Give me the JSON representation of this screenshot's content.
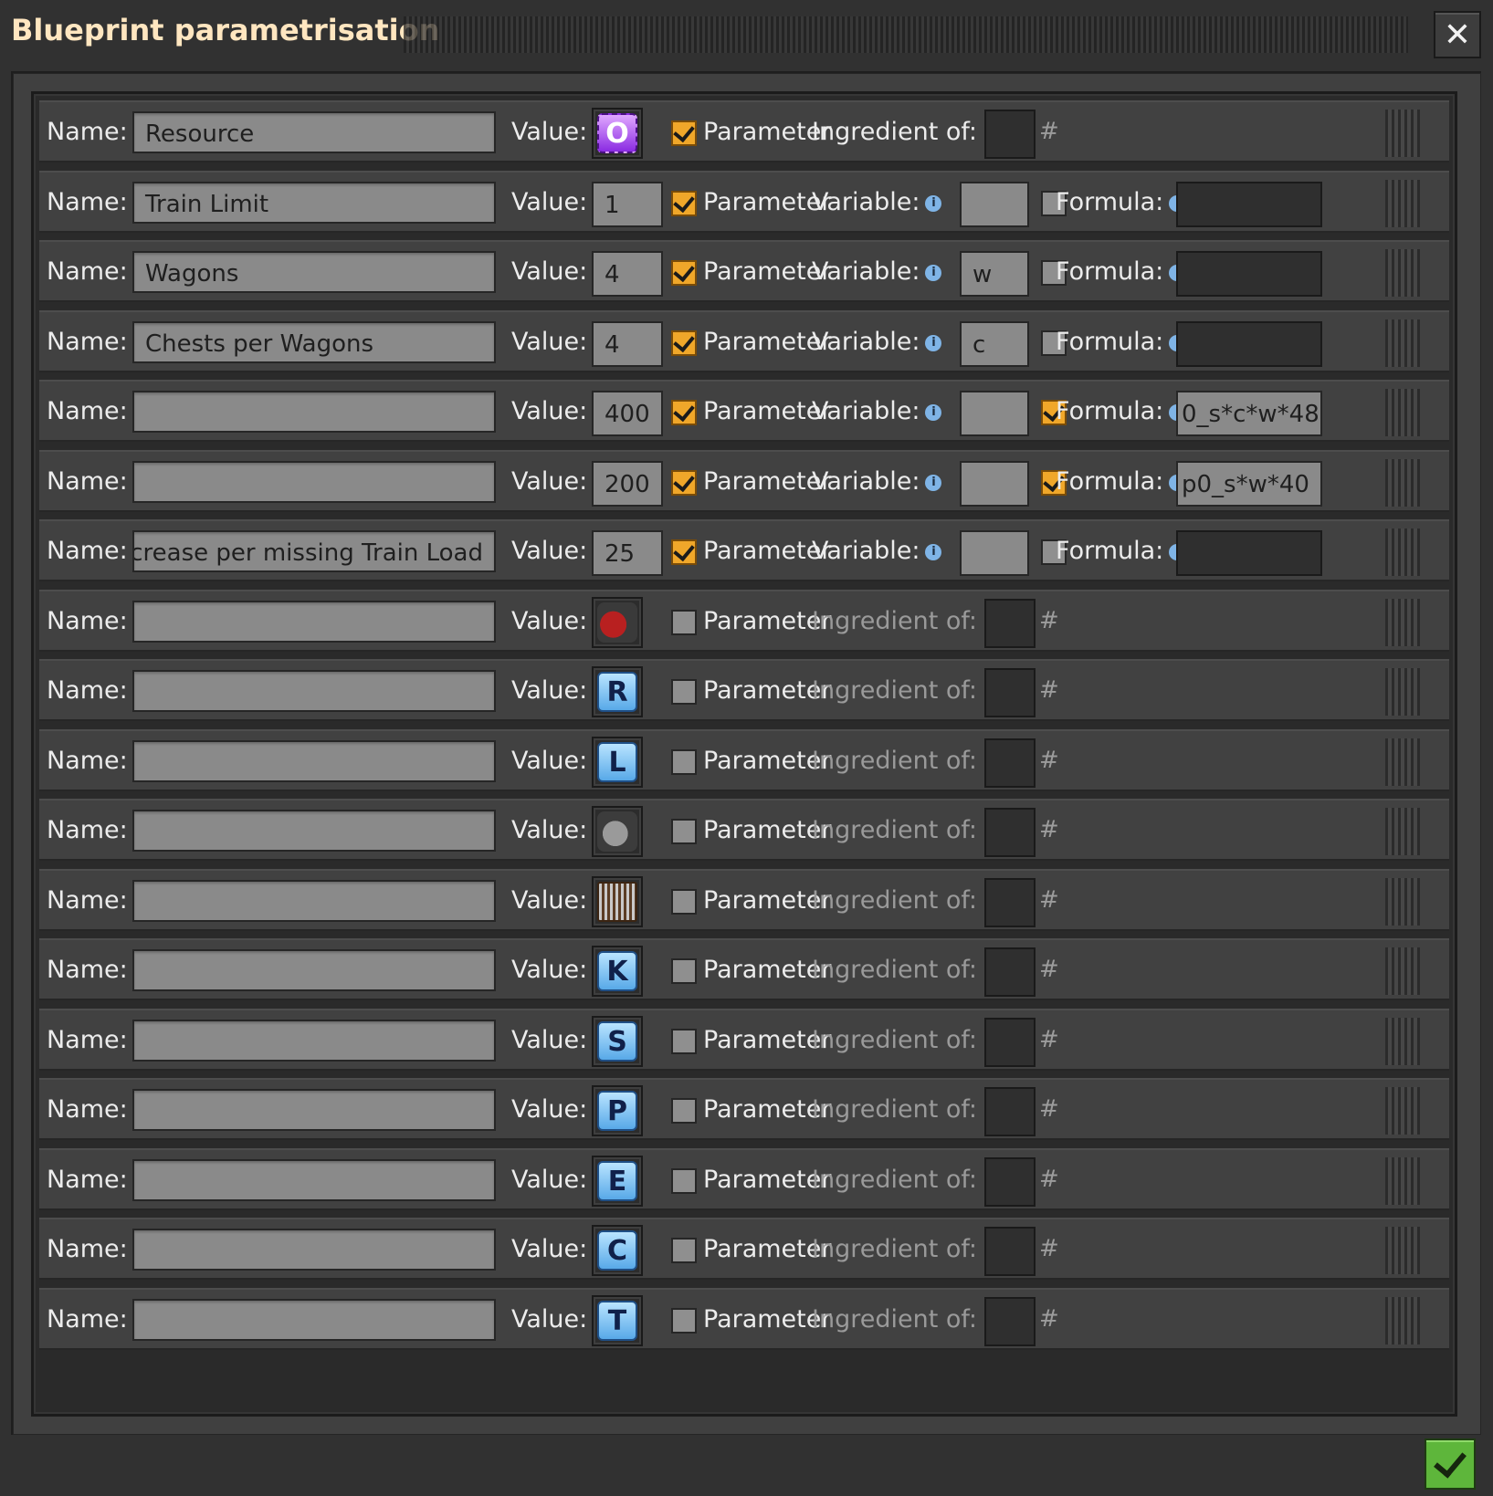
{
  "window": {
    "title": "Blueprint parametrisation",
    "close_icon": "close-icon",
    "confirm_icon": "checkmark-icon"
  },
  "labels": {
    "name": "Name:",
    "value": "Value:",
    "parameter": "Parameter",
    "ingredient_of": "Ingredient of:",
    "variable": "Variable:",
    "formula": "Formula:",
    "hash": "#"
  },
  "rows": [
    {
      "name": "Resource",
      "value_type": "signal",
      "value_icon": "signal-O",
      "value_glyph": "O",
      "value_color": "purple",
      "parameter": true,
      "mode": "ingredient"
    },
    {
      "name": "Train Limit",
      "value_type": "number",
      "value": "1",
      "parameter": true,
      "mode": "variable",
      "variable": "",
      "formula_checked": false,
      "formula": ""
    },
    {
      "name": "Wagons",
      "value_type": "number",
      "value": "4",
      "parameter": true,
      "mode": "variable",
      "variable": "w",
      "formula_checked": false,
      "formula": ""
    },
    {
      "name": "Chests per Wagons",
      "value_type": "number",
      "value": "4",
      "parameter": true,
      "mode": "variable",
      "variable": "c",
      "formula_checked": false,
      "formula": ""
    },
    {
      "name": "",
      "value_type": "number",
      "value": "400",
      "parameter": true,
      "mode": "variable",
      "variable": "",
      "formula_checked": true,
      "formula": "0_s*c*w*48"
    },
    {
      "name": "",
      "value_type": "number",
      "value": "200",
      "parameter": true,
      "mode": "variable",
      "variable": "",
      "formula_checked": true,
      "formula": "p0_s*w*40"
    },
    {
      "name": "y Increase per missing Train Load",
      "value_type": "number",
      "value": "25",
      "parameter": true,
      "mode": "variable",
      "variable": "",
      "formula_checked": false,
      "formula": ""
    },
    {
      "name": "",
      "value_type": "item",
      "value_icon": "locomotive-icon",
      "parameter": false,
      "mode": "ingredient"
    },
    {
      "name": "",
      "value_type": "signal",
      "value_icon": "signal-R",
      "value_glyph": "R",
      "parameter": false,
      "mode": "ingredient"
    },
    {
      "name": "",
      "value_type": "signal",
      "value_icon": "signal-L",
      "value_glyph": "L",
      "parameter": false,
      "mode": "ingredient"
    },
    {
      "name": "",
      "value_type": "item",
      "value_icon": "cargo-wagon-icon",
      "parameter": false,
      "mode": "ingredient"
    },
    {
      "name": "",
      "value_type": "item",
      "value_icon": "wooden-chest-icon",
      "parameter": false,
      "mode": "ingredient"
    },
    {
      "name": "",
      "value_type": "signal",
      "value_icon": "signal-K",
      "value_glyph": "K",
      "parameter": false,
      "mode": "ingredient"
    },
    {
      "name": "",
      "value_type": "signal",
      "value_icon": "signal-S",
      "value_glyph": "S",
      "parameter": false,
      "mode": "ingredient"
    },
    {
      "name": "",
      "value_type": "signal",
      "value_icon": "signal-P",
      "value_glyph": "P",
      "parameter": false,
      "mode": "ingredient"
    },
    {
      "name": "",
      "value_type": "signal",
      "value_icon": "signal-E",
      "value_glyph": "E",
      "parameter": false,
      "mode": "ingredient"
    },
    {
      "name": "",
      "value_type": "signal",
      "value_icon": "signal-C",
      "value_glyph": "C",
      "parameter": false,
      "mode": "ingredient"
    },
    {
      "name": "",
      "value_type": "signal",
      "value_icon": "signal-T",
      "value_glyph": "T",
      "parameter": false,
      "mode": "ingredient"
    }
  ],
  "colors": {
    "checkbox_on": "#f0a72a",
    "confirm_button": "#5eb63b",
    "title_text": "#ffe6c0"
  }
}
